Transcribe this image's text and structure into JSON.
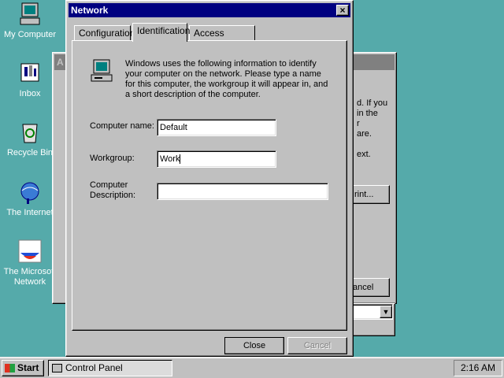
{
  "desktop": {
    "icons": [
      {
        "label": "My Computer",
        "icon": "computer-icon"
      },
      {
        "label": "Inbox",
        "icon": "inbox-icon"
      },
      {
        "label": "Recycle Bin",
        "icon": "recycle-bin-icon"
      },
      {
        "label": "The Internet",
        "icon": "internet-icon"
      },
      {
        "label": "The Microsoft Network",
        "icon": "msn-icon"
      }
    ]
  },
  "background_window": {
    "title_fragment": "A",
    "text_lines": [
      "d. If you",
      "in the",
      "r",
      "are.",
      "ext."
    ],
    "button_print": "rint...",
    "button_cancel": "ancel"
  },
  "dialog": {
    "title": "Network",
    "tabs": [
      "Configuration",
      "Identification",
      "Access Control"
    ],
    "active_tab": "Identification",
    "description": "Windows uses the following information to identify your computer on the network.  Please type a name for this computer, the workgroup it will appear in, and a short description of the computer.",
    "computer_name_label": "Computer name:",
    "computer_name_value": "Default",
    "workgroup_label": "Workgroup:",
    "workgroup_value": "Work",
    "computer_description_label_1": "Computer",
    "computer_description_label_2": "Description:",
    "computer_description_value": "",
    "close_button": "Close",
    "cancel_button": "Cancel"
  },
  "taskbar": {
    "start_label": "Start",
    "task_label": "Control Panel",
    "clock": "2:16 AM"
  },
  "colors": {
    "desktop": "#55aaaa",
    "titlebar": "#000080",
    "face": "#c0c0c0"
  }
}
